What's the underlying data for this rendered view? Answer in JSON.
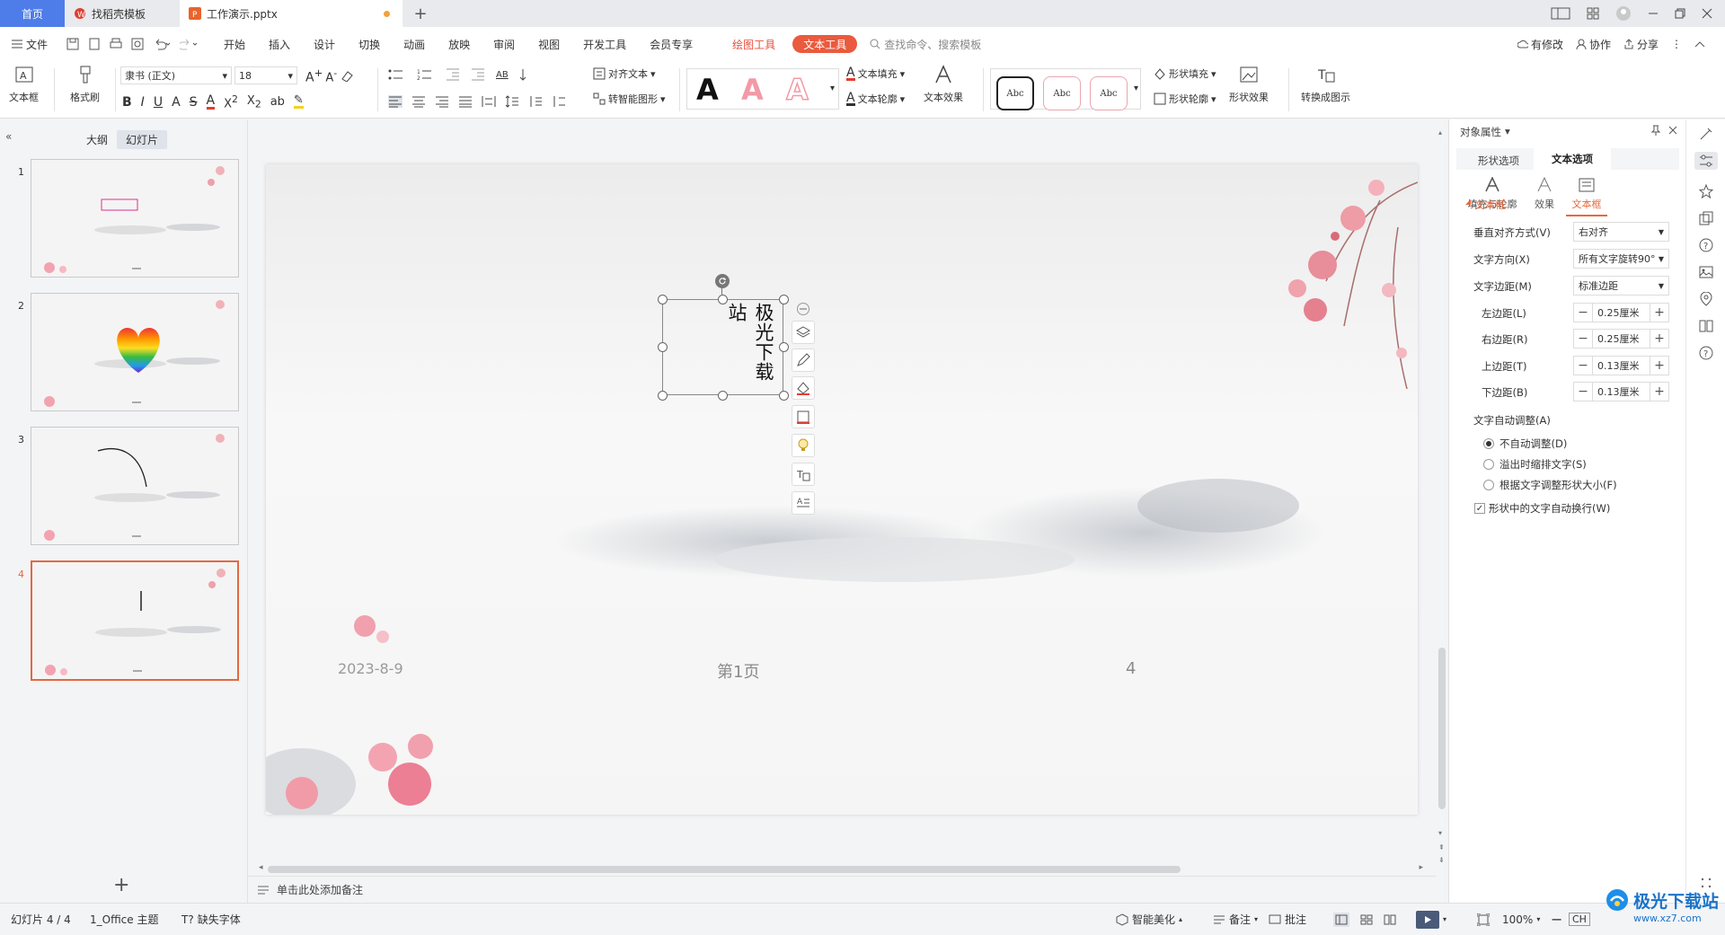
{
  "tabs": {
    "home": "首页",
    "template": "找稻壳模板",
    "document": "工作演示.pptx"
  },
  "menu": {
    "file": "文件",
    "items": [
      "开始",
      "插入",
      "设计",
      "切换",
      "动画",
      "放映",
      "审阅",
      "视图",
      "开发工具",
      "会员专享"
    ],
    "draw_tool": "绘图工具",
    "text_tool": "文本工具",
    "search_placeholder": "查找命令、搜索模板",
    "has_changes": "有修改",
    "collaborate": "协作",
    "share": "分享"
  },
  "toolbar": {
    "textbox": "文本框",
    "format_painter": "格式刷",
    "font_name": "隶书 (正文)",
    "font_size": "18",
    "text_direction": "AB",
    "align_text": "对齐文本",
    "smart_shape": "转智能图形",
    "text_fill": "文本填充",
    "text_outline": "文本轮廓",
    "text_effect": "文本效果",
    "abc_label": "Abc",
    "shape_fill": "形状填充",
    "shape_outline": "形状轮廓",
    "shape_effect": "形状效果",
    "convert_diagram": "转换成图示",
    "wordart_glyph": "A"
  },
  "left_panel": {
    "tab_outline": "大纲",
    "tab_slides": "幻灯片",
    "slide_numbers": [
      "1",
      "2",
      "3",
      "4"
    ]
  },
  "slide": {
    "textbox_text": "极光下载站",
    "date": "2023-8-9",
    "page_label": "第1页",
    "page_number": "4"
  },
  "notes": {
    "placeholder": "单击此处添加备注"
  },
  "right_panel": {
    "title": "对象属性",
    "tab_shape": "形状选项",
    "tab_text": "文本选项",
    "sub_fill": "填充与轮廓",
    "sub_effect": "效果",
    "sub_textbox": "文本框",
    "section": "文本框",
    "vertical_align_label": "垂直对齐方式(V)",
    "vertical_align_value": "右对齐",
    "text_direction_label": "文字方向(X)",
    "text_direction_value": "所有文字旋转90°",
    "margin_label": "文字边距(M)",
    "margin_value": "标准边距",
    "left_margin_label": "左边距(L)",
    "left_margin_value": "0.25厘米",
    "right_margin_label": "右边距(R)",
    "right_margin_value": "0.25厘米",
    "top_margin_label": "上边距(T)",
    "top_margin_value": "0.13厘米",
    "bottom_margin_label": "下边距(B)",
    "bottom_margin_value": "0.13厘米",
    "autofit_label": "文字自动调整(A)",
    "autofit_none": "不自动调整(D)",
    "autofit_shrink": "溢出时缩排文字(S)",
    "autofit_resize": "根据文字调整形状大小(F)",
    "wrap_text": "形状中的文字自动换行(W)"
  },
  "statusbar": {
    "slide_info": "幻灯片 4 / 4",
    "theme": "1_Office 主题",
    "missing_font": "缺失字体",
    "smart_beautify": "智能美化",
    "notes": "备注",
    "comments": "批注",
    "zoom": "100%",
    "ime": "CH",
    "watermark": "极光下载站",
    "watermark_url": "www.xz7.com"
  },
  "colors": {
    "accent": "#ea5a3e",
    "blue": "#4e7de9",
    "selected_border": "#e5683f"
  }
}
